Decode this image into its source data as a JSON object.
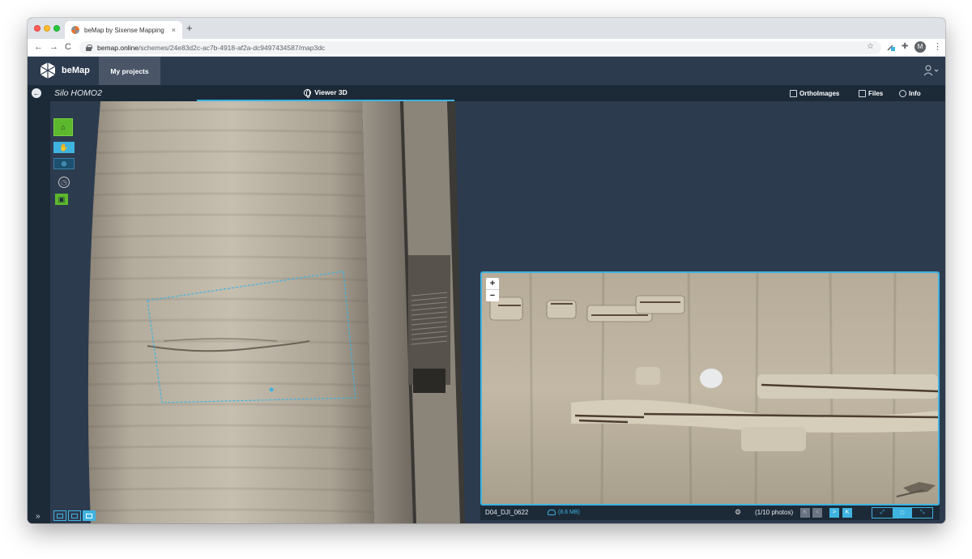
{
  "browser": {
    "tab_title": "beMap by Sixense Mapping",
    "tab_close": "×",
    "new_tab": "+",
    "url_host": "bemap.online",
    "url_path": "/schemes/24e83d2c-ac7b-4918-af2a-dc9497434587/map3dc",
    "back": "←",
    "forward": "→",
    "reload": "C",
    "star": "☆",
    "profile_initial": "M",
    "menu": "⋮"
  },
  "app": {
    "brand": "beMap",
    "my_projects": "My projects"
  },
  "subheader": {
    "back": "←",
    "project_title": "Silo HOMO2",
    "viewer_tab": "Viewer 3D",
    "ortho_tab": "OrthoImages",
    "files_tab": "Files",
    "info_tab": "Info"
  },
  "toolbar": {
    "home": "⌂",
    "pan": "✋",
    "crosshair": "⊕",
    "measure": "◷",
    "photo": "▣",
    "expand": "»"
  },
  "photo": {
    "zoom_in": "+",
    "zoom_out": "−",
    "name": "D04_DJI_0622",
    "size": "(8.6 MB)",
    "count": "(1/10 photos)",
    "first": "K",
    "prev": "<",
    "next": ">",
    "last": "K",
    "filter": "⚙",
    "size_opts": [
      "⤢",
      "□",
      "⤡"
    ]
  },
  "colors": {
    "accent": "#3fb3e0",
    "green": "#5cb82c",
    "header_bg": "#2d3b4f",
    "subheader_bg": "#1c2a38"
  }
}
